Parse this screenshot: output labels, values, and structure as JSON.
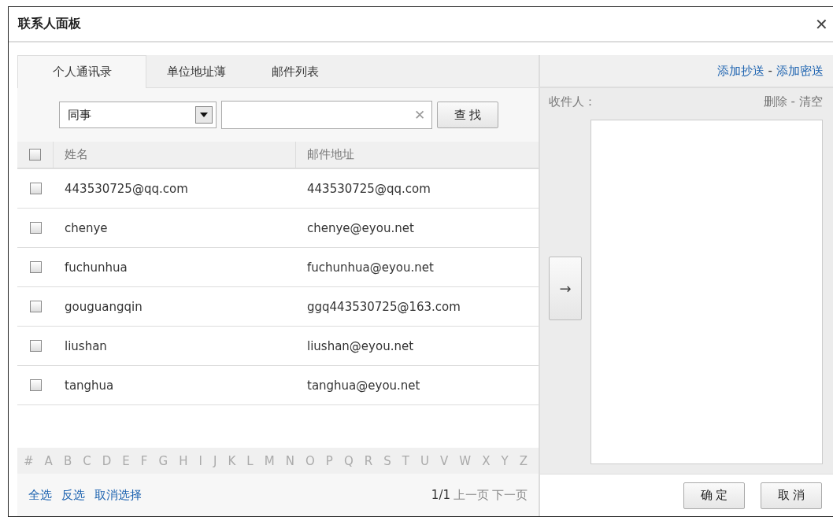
{
  "window": {
    "title": "联系人面板",
    "close": "✕"
  },
  "tabs": [
    {
      "label": "个人通讯录",
      "selected": true
    },
    {
      "label": "单位地址薄",
      "selected": false
    },
    {
      "label": "邮件列表",
      "selected": false
    }
  ],
  "filter": {
    "group": "同事",
    "clear": "✕",
    "search_button": "查 找"
  },
  "table": {
    "columns": [
      "姓名",
      "邮件地址"
    ],
    "all_checked": false,
    "rows": [
      {
        "name": "443530725@qq.com",
        "email": "443530725@qq.com",
        "checked": false
      },
      {
        "name": "chenye",
        "email": "chenye@eyou.net",
        "checked": false
      },
      {
        "name": "fuchunhua",
        "email": "fuchunhua@eyou.net",
        "checked": false
      },
      {
        "name": "gouguangqin",
        "email": "ggq443530725@163.com",
        "checked": false
      },
      {
        "name": "liushan",
        "email": "liushan@eyou.net",
        "checked": false
      },
      {
        "name": "tanghua",
        "email": "tanghua@eyou.net",
        "checked": false
      }
    ]
  },
  "letters": [
    "#",
    "A",
    "B",
    "C",
    "D",
    "E",
    "F",
    "G",
    "H",
    "I",
    "J",
    "K",
    "L",
    "M",
    "N",
    "O",
    "P",
    "Q",
    "R",
    "S",
    "T",
    "U",
    "V",
    "W",
    "X",
    "Y",
    "Z"
  ],
  "selection_links": [
    "全选",
    "反选",
    "取消选择"
  ],
  "pager": {
    "page": "1/1",
    "prev": "上一页",
    "next": "下一页"
  },
  "recipients": {
    "add_links": [
      "添加抄送",
      "添加密送"
    ],
    "label": "收件人：",
    "edit_links": [
      "删除",
      "清空"
    ],
    "separator": "-",
    "add_button": "→"
  },
  "buttons": [
    "确 定",
    "取 消"
  ]
}
